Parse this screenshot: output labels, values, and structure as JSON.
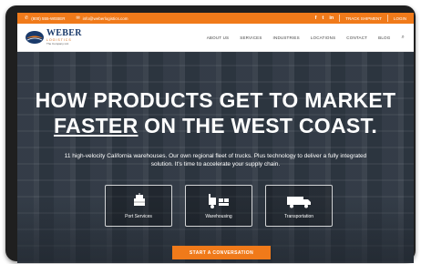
{
  "topbar": {
    "phone": "(800) 555-WEBER",
    "email": "info@weberlogistics.com",
    "social": [
      "f",
      "t",
      "in"
    ],
    "track_label": "TRACK SHIPMENT",
    "login_label": "LOGIN",
    "phone_icon": "phone-icon",
    "email_icon": "email-icon"
  },
  "brand": {
    "name": "WEBER",
    "sub": "LOGISTICS",
    "tagline": "The Company Ltd."
  },
  "nav": {
    "items": [
      "ABOUT US",
      "SERVICES",
      "INDUSTRIES",
      "LOCATIONS",
      "CONTACT",
      "BLOG"
    ],
    "search_icon": "search-icon"
  },
  "hero": {
    "line1": "HOW PRODUCTS GET TO MARKET",
    "line2_underlined": "FASTER",
    "line2_rest": " ON THE WEST COAST.",
    "subtext": "11 high-velocity California warehouses. Our own regional fleet of trucks. Plus technology to deliver a fully integrated solution. It's time to accelerate your supply chain.",
    "services": [
      {
        "label": "Port Services",
        "icon": "crane-icon"
      },
      {
        "label": "Warehousing",
        "icon": "forklift-icon"
      },
      {
        "label": "Transportation",
        "icon": "truck-icon"
      }
    ],
    "cta_label": "START A CONVERSATION"
  },
  "colors": {
    "accent": "#f07a1a",
    "brand_blue": "#1a3a6b"
  }
}
